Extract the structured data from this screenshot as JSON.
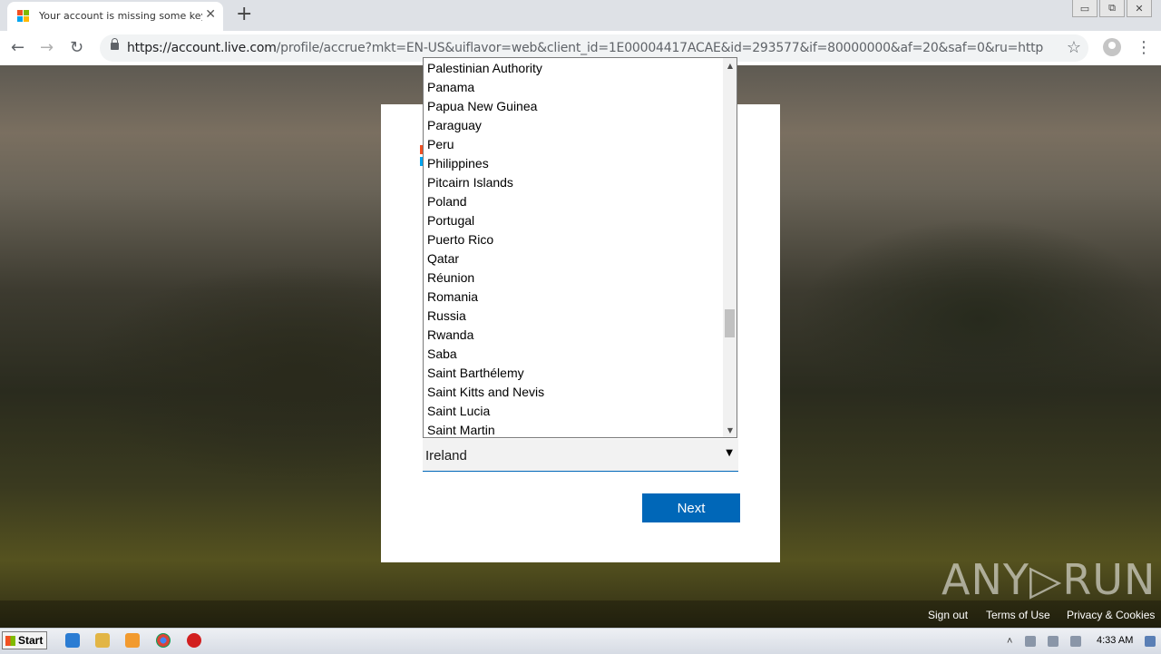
{
  "browser": {
    "tab_title": "Your account is missing some key info",
    "tab_close": "✕",
    "new_tab": "+",
    "url_host": "https://account.live.com",
    "url_path": "/profile/accrue?mkt=EN-US&uiflavor=web&client_id=1E00004417ACAE&id=293577&if=80000000&af=20&saf=0&ru=https://login.live.com/...",
    "window_buttons": [
      "▭",
      "⧉",
      "✕"
    ]
  },
  "form": {
    "country_selected": "Ireland",
    "select_arrow": "▼",
    "next_label": "Next",
    "country_options": [
      "Palestinian Authority",
      "Panama",
      "Papua New Guinea",
      "Paraguay",
      "Peru",
      "Philippines",
      "Pitcairn Islands",
      "Poland",
      "Portugal",
      "Puerto Rico",
      "Qatar",
      "Réunion",
      "Romania",
      "Russia",
      "Rwanda",
      "Saba",
      "Saint Barthélemy",
      "Saint Kitts and Nevis",
      "Saint Lucia",
      "Saint Martin"
    ],
    "scroll_position": 0.62
  },
  "footer": {
    "sign_out": "Sign out",
    "terms": "Terms of Use",
    "privacy": "Privacy & Cookies"
  },
  "watermark": "ANY▷RUN",
  "taskbar": {
    "start_label": "Start",
    "clock": "4:33 AM"
  },
  "colors": {
    "accent": "#0067b8"
  }
}
